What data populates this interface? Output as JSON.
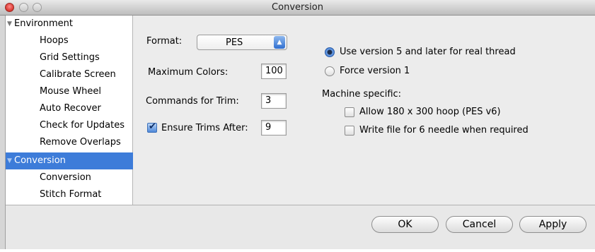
{
  "window": {
    "title": "Conversion"
  },
  "sidebar": {
    "items": [
      {
        "label": "Environment",
        "level": "top",
        "expanded": true
      },
      {
        "label": "Hoops",
        "level": "child"
      },
      {
        "label": "Grid Settings",
        "level": "child"
      },
      {
        "label": "Calibrate Screen",
        "level": "child"
      },
      {
        "label": "Mouse Wheel",
        "level": "child"
      },
      {
        "label": "Auto Recover",
        "level": "child"
      },
      {
        "label": "Check for Updates",
        "level": "child"
      },
      {
        "label": "Remove Overlaps",
        "level": "child"
      },
      {
        "label": "Conversion",
        "level": "top",
        "expanded": true,
        "selected": true
      },
      {
        "label": "Conversion",
        "level": "child"
      },
      {
        "label": "Stitch Format",
        "level": "child"
      }
    ]
  },
  "form": {
    "format_label": "Format:",
    "format_value": "PES",
    "max_colors_label": "Maximum Colors:",
    "max_colors_value": "100",
    "commands_trim_label": "Commands for Trim:",
    "commands_trim_value": "3",
    "ensure_trims_label": "Ensure Trims After:",
    "ensure_trims_checked": true,
    "ensure_trims_value": "9",
    "radio_v5_label": "Use version 5 and later for real thread",
    "radio_v5_selected": true,
    "radio_v1_label": "Force version 1",
    "radio_v1_selected": false,
    "machine_specific_label": "Machine specific:",
    "hoop_label": "Allow 180 x 300 hoop (PES v6)",
    "hoop_checked": false,
    "six_needle_label": "Write file for 6 needle when required",
    "six_needle_checked": false
  },
  "buttons": {
    "ok": "OK",
    "cancel": "Cancel",
    "apply": "Apply"
  },
  "colors": {
    "selection": "#3d7cd9",
    "pane": "#ececec"
  }
}
